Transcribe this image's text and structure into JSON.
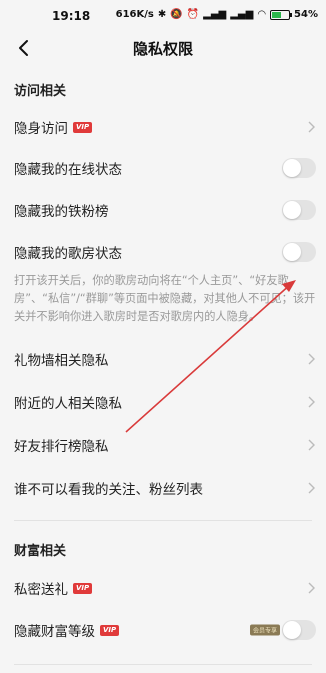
{
  "status_bar": {
    "time": "19:18",
    "network_speed": "616K/s",
    "battery_percent": "54",
    "battery_level": 0.54,
    "icons": [
      "bluetooth-icon",
      "mute-icon",
      "alarm-icon",
      "signal-hd-icon",
      "signal-hd-2-icon",
      "wifi-icon",
      "battery-icon"
    ]
  },
  "nav": {
    "title": "隐私权限"
  },
  "sections": {
    "access": {
      "title": "访问相关"
    },
    "wealth": {
      "title": "财富相关"
    }
  },
  "rows": {
    "invisible_visit": {
      "label": "隐身访问",
      "badge": "VIP"
    },
    "hide_online": {
      "label": "隐藏我的在线状态",
      "toggle_on": false
    },
    "hide_fans": {
      "label": "隐藏我的铁粉榜",
      "toggle_on": false
    },
    "hide_room": {
      "label": "隐藏我的歌房状态",
      "toggle_on": false
    },
    "room_helper": "打开该开关后，你的歌房动向将在“个人主页”、“好友歌房”、“私信”/“群聊”等页面中被隐藏，对其他人不可见；该开关并不影响你进入歌房时是否对歌房内的人隐身。",
    "gift_wall": {
      "label": "礼物墙相关隐私"
    },
    "nearby": {
      "label": "附近的人相关隐私"
    },
    "friend_rank": {
      "label": "好友排行榜隐私"
    },
    "follow_list": {
      "label": "谁不可以看我的关注、粉丝列表"
    },
    "secret_gift": {
      "label": "私密送礼",
      "badge": "VIP"
    },
    "hide_wealth": {
      "label": "隐藏财富等级",
      "badge": "VIP",
      "exclusive_tag": "会员专享",
      "toggle_on": false
    }
  },
  "colors": {
    "background": "#f5f5f5",
    "vip_badge": "#e03a3a",
    "annotation_arrow": "#d93a3a",
    "toggle_off": "#e3e3e3"
  }
}
